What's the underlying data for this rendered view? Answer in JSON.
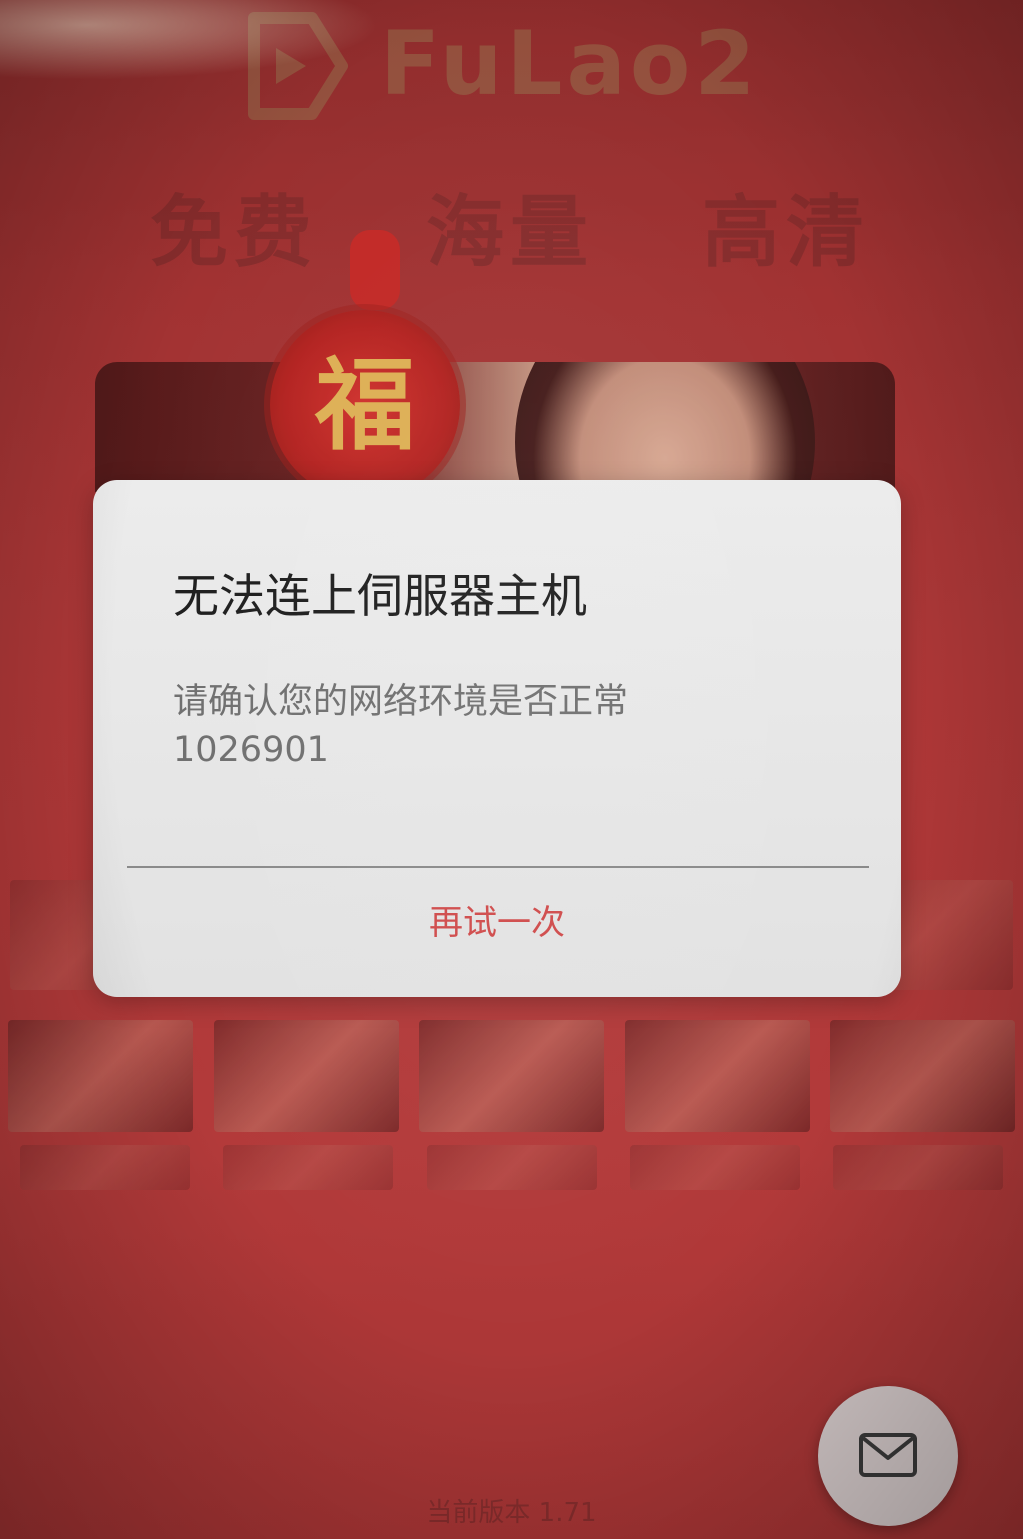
{
  "app": {
    "logo_text": "FuLao2",
    "logo_icon": "play-icon"
  },
  "tagline": {
    "items": [
      "免费",
      "海量",
      "高清"
    ]
  },
  "banner": {
    "ornament_char": "福"
  },
  "dialog": {
    "title": "无法连上伺服器主机",
    "message_line1": "请确认您的网络环境是否正常",
    "message_line2": "1026901",
    "retry_label": "再试一次"
  },
  "footer": {
    "version_text": "当前版本 1.71"
  },
  "fab": {
    "icon": "mail-icon"
  },
  "colors": {
    "background": "#b23a3a",
    "dialog_bg": "#e6e6e6",
    "retry_text": "#cf4a4a",
    "title_text": "#1e1e1e",
    "message_text": "#6f6f6f"
  }
}
